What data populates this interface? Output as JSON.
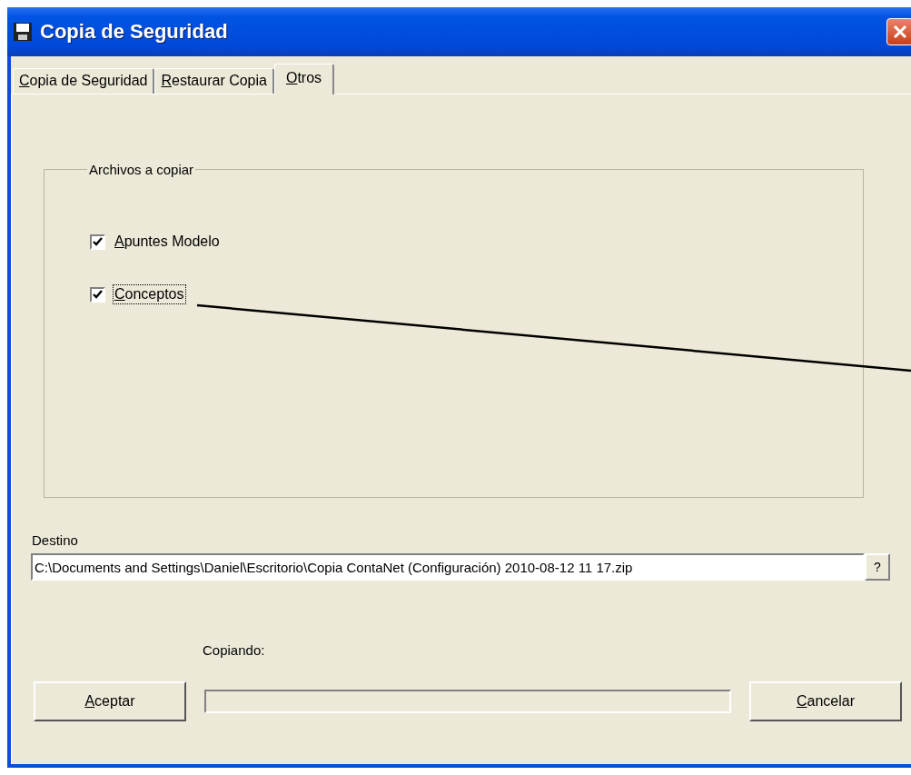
{
  "window": {
    "title": "Copia de Seguridad"
  },
  "tabs": [
    {
      "label": "Copia de Seguridad",
      "selected": false,
      "mnemonic": true
    },
    {
      "label": "Restaurar Copia",
      "selected": false,
      "mnemonic": true
    },
    {
      "label": "Otros",
      "selected": true,
      "mnemonic": true
    }
  ],
  "group": {
    "title": "Archivos a copiar",
    "items": [
      {
        "label": "Apuntes Modelo",
        "checked": true,
        "focused": false,
        "mnemonic": true
      },
      {
        "label": "Conceptos",
        "checked": true,
        "focused": true,
        "mnemonic": true
      }
    ]
  },
  "destination": {
    "label": "Destino",
    "value": "C:\\Documents and Settings\\Daniel\\Escritorio\\Copia ContaNet (Configuración) 2010-08-12 11 17.zip",
    "browse": "?"
  },
  "progress": {
    "label": "Copiando:",
    "level": 0
  },
  "buttons": [
    {
      "label": "Aceptar",
      "mnemonic": true
    },
    {
      "label": "Cancelar",
      "mnemonic": true
    }
  ]
}
